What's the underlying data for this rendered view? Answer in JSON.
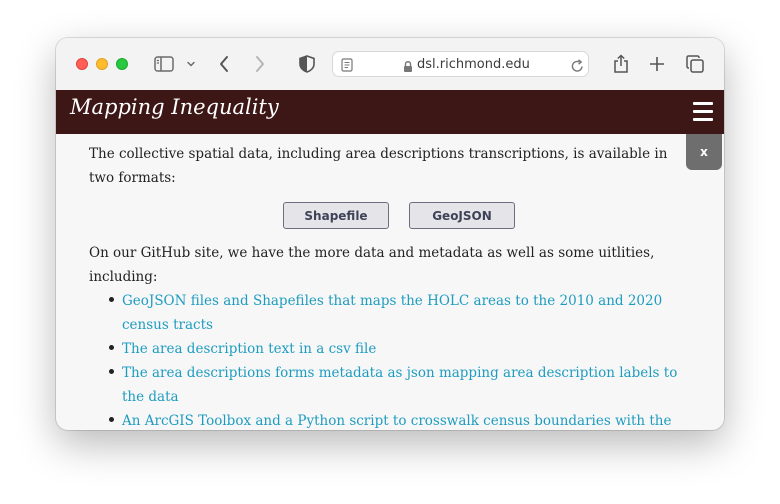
{
  "browser": {
    "url": "dsl.richmond.edu"
  },
  "site": {
    "brand": "Mapping Inequality",
    "close_label": "x"
  },
  "content": {
    "intro": "The collective spatial data, including area descriptions transcriptions, is available in two formats:",
    "buttons": [
      "Shapefile",
      "GeoJSON"
    ],
    "github_intro": "On our GitHub site, we have the more data and metadata as well as some uitlities, including:",
    "links": [
      "GeoJSON files and Shapefiles that maps the HOLC areas to the 2010 and 2020 census tracts",
      "The area description text in a csv file",
      "The area descriptions forms metadata as json mapping area description labels to the data",
      "An ArcGIS Toolbox and a Python script to crosswalk census boundaries with the HOLC areas"
    ]
  },
  "colors": {
    "navbar": "#3d1616",
    "link": "#1e9cc0",
    "button_fill": "#e4e4e9",
    "button_border": "#6d6f7f"
  },
  "icons": [
    "sidebar-icon",
    "chevron-down-icon",
    "back-icon",
    "forward-icon",
    "shield-icon",
    "reader-icon",
    "lock-icon",
    "reload-icon",
    "share-icon",
    "plus-icon",
    "tabs-icon",
    "hamburger-icon"
  ]
}
